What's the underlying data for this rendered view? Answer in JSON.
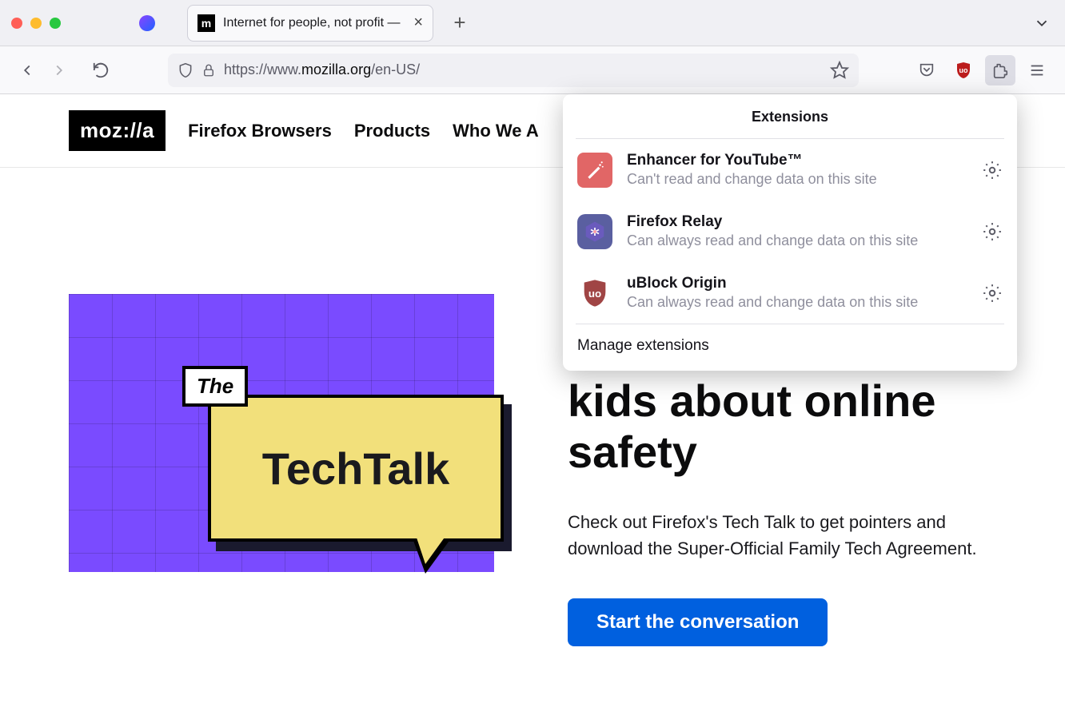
{
  "tab": {
    "title": "Internet for people, not profit —",
    "favicon_letter": "m"
  },
  "url": {
    "protocol": "https://",
    "host": "www.",
    "domain": "mozilla.org",
    "path": "/en-US/"
  },
  "site": {
    "logo": "moz://a",
    "nav": [
      "Firefox Browsers",
      "Products",
      "Who We A"
    ]
  },
  "hero": {
    "tag": "The",
    "bubble": "TechTalk",
    "heading": "kids about online safety",
    "body": "Check out Firefox's Tech Talk to get pointers and download the Super-Official Family Tech Agreement.",
    "cta": "Start the conversation"
  },
  "extensions_popup": {
    "title": "Extensions",
    "items": [
      {
        "name": "Enhancer for YouTube™",
        "status": "Can't read and change data on this site",
        "icon": "youtube"
      },
      {
        "name": "Firefox Relay",
        "status": "Can always read and change data on this site",
        "icon": "relay"
      },
      {
        "name": "uBlock Origin",
        "status": "Can always read and change data on this site",
        "icon": "ublock"
      }
    ],
    "footer": "Manage extensions"
  }
}
